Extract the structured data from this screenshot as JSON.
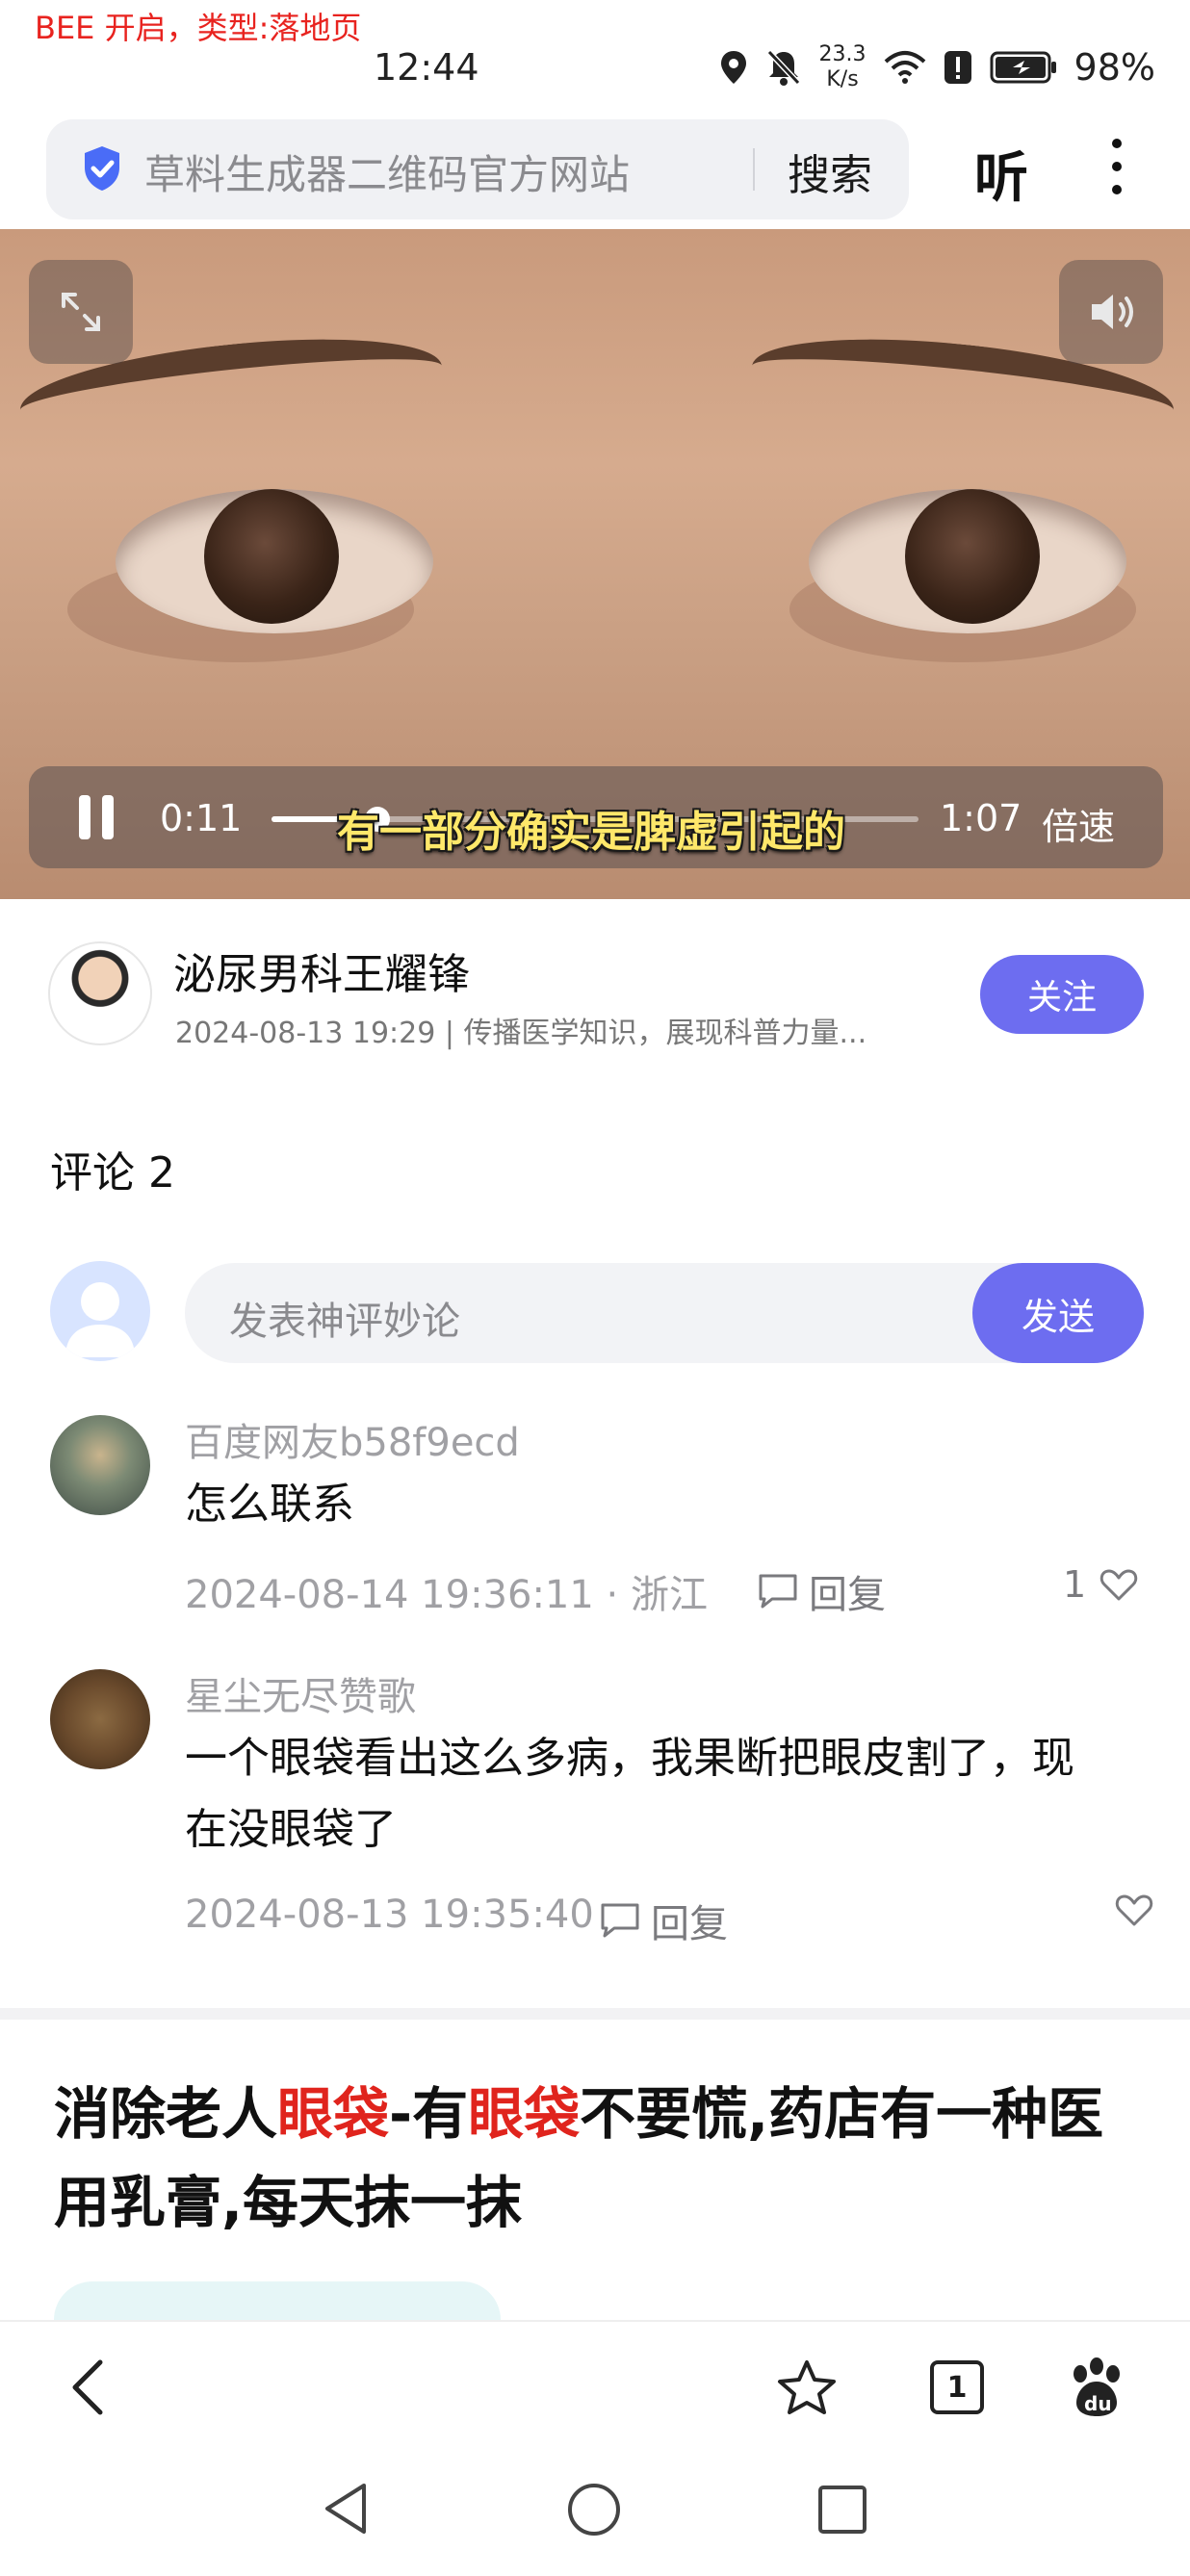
{
  "status_bar": {
    "debug_tag": "BEE 开启，类型:落地页",
    "time": "12:44",
    "net_speed_value": "23.3",
    "net_speed_unit": "K/s",
    "battery": "98%"
  },
  "search_bar": {
    "query": "草料生成器二维码官方网站",
    "search_label": "搜索",
    "listen_label": "听"
  },
  "video": {
    "current_time": "0:11",
    "duration": "1:07",
    "progress": 0.164,
    "speed_label": "倍速",
    "subtitle": "有一部分确实是脾虚引起的"
  },
  "author": {
    "name": "泌尿男科王耀锋",
    "meta": "2024-08-13 19:29 | 传播医学知识，展现科普力量...",
    "follow_label": "关注"
  },
  "comments": {
    "title": "评论 2",
    "input_placeholder": "发表神评妙论",
    "send_label": "发送",
    "reply_label": "回复",
    "items": [
      {
        "user": "百度网友b58f9ecd",
        "text": "怎么联系",
        "meta": "2024-08-14 19:36:11 · 浙江",
        "likes": "1"
      },
      {
        "user": "星尘无尽赞歌",
        "text": "一个眼袋看出这么多病，我果断把眼皮割了，现在没眼袋了",
        "meta": "2024-08-13 19:35:40",
        "likes": ""
      }
    ]
  },
  "article": {
    "title_part1": "消除老人",
    "title_hl1": "眼袋",
    "title_part2": "-有",
    "title_hl2": "眼袋",
    "title_part3": "不要慌,药店有一种医用乳膏,每天抹一抹"
  },
  "toolbar": {
    "tab_count": "1"
  },
  "colors": {
    "accent": "#6d6df0",
    "highlight_red": "#e0241d",
    "subtitle_yellow": "#ffe86a"
  }
}
